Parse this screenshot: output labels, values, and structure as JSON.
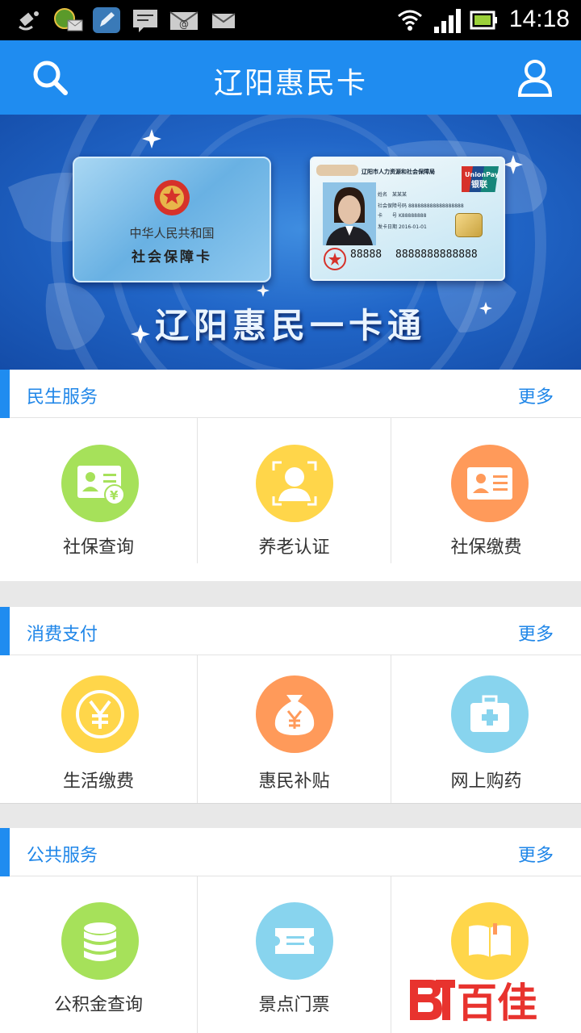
{
  "status_bar": {
    "time": "14:18",
    "icons": [
      "satellite-icon",
      "globe-mail-icon",
      "edit-app-icon",
      "message-icon",
      "email-icon",
      "email-small-icon",
      "wifi-icon",
      "signal-icon",
      "battery-icon"
    ]
  },
  "header": {
    "title": "辽阳惠民卡",
    "left_icon": "search-icon",
    "right_icon": "user-icon"
  },
  "banner": {
    "slogan": "辽阳惠民一卡通",
    "card_left": {
      "line1": "中华人民共和国",
      "line2": "社会保障卡"
    },
    "card_right": {
      "issuer": "辽阳市人力资源和社会保障局",
      "brand": "UnionPay 银联",
      "name_label": "姓名",
      "name_value": "某某某",
      "id_label": "社会保障号码",
      "id_value": "888888888888888888",
      "card_label": "卡　　号",
      "card_value": "K88888888",
      "date_label": "发卡日期",
      "date_value": "2016-01-01",
      "num_short": "88888",
      "num_long": "8888888888888"
    }
  },
  "sections": [
    {
      "title": "民生服务",
      "more": "更多",
      "items": [
        {
          "label": "社保查询",
          "icon": "id-card-yuan-icon",
          "color": "#a6e15a"
        },
        {
          "label": "养老认证",
          "icon": "face-scan-icon",
          "color": "#ffd64a"
        },
        {
          "label": "社保缴费",
          "icon": "id-card-icon",
          "color": "#ff9a5a"
        }
      ]
    },
    {
      "title": "消费支付",
      "more": "更多",
      "items": [
        {
          "label": "生活缴费",
          "icon": "yuan-coin-icon",
          "color": "#ffd64a"
        },
        {
          "label": "惠民补贴",
          "icon": "money-bag-icon",
          "color": "#ff9a5a"
        },
        {
          "label": "网上购药",
          "icon": "medical-kit-icon",
          "color": "#88d4ee"
        }
      ]
    },
    {
      "title": "公共服务",
      "more": "更多",
      "items": [
        {
          "label": "公积金查询",
          "icon": "coin-stack-icon",
          "color": "#a6e15a"
        },
        {
          "label": "景点门票",
          "icon": "ticket-icon",
          "color": "#88d4ee"
        },
        {
          "label": "",
          "icon": "book-icon",
          "color": "#ffd64a"
        }
      ]
    }
  ],
  "watermark": {
    "text": "百佳",
    "icon": "baijia-logo-icon"
  }
}
